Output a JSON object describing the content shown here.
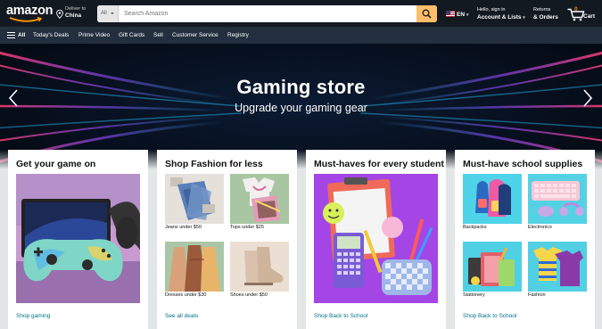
{
  "header": {
    "logo": "amazon",
    "deliver_to_label": "Deliver to",
    "deliver_to_location": "China",
    "search_category": "All",
    "search_placeholder": "Search Amazon",
    "language": "EN",
    "account_greeting": "Hello, sign in",
    "account_label": "Account & Lists",
    "returns_label": "Returns",
    "orders_label": "& Orders",
    "cart_count": "0",
    "cart_label": "Cart"
  },
  "subnav": {
    "all_label": "All",
    "items": [
      "Today's Deals",
      "Prime Video",
      "Gift Cards",
      "Sell",
      "Customer Service",
      "Registry"
    ]
  },
  "hero": {
    "title": "Gaming store",
    "subtitle": "Upgrade your gaming gear"
  },
  "cards": [
    {
      "title": "Get your game on",
      "footer_link": "Shop gaming"
    },
    {
      "title": "Shop Fashion for less",
      "footer_link": "See all deals",
      "tiles": [
        "Jeans under $50",
        "Tops under $25",
        "Dresses under $30",
        "Shoes under $50"
      ]
    },
    {
      "title": "Must-haves for every student",
      "footer_link": "Shop Back to School"
    },
    {
      "title": "Must-have school supplies",
      "footer_link": "Shop Back to School",
      "tiles": [
        "Backpacks",
        "Electronics",
        "Stationery",
        "Fashion"
      ]
    }
  ],
  "colors": {
    "nav_top": "#131921",
    "nav_sub": "#232f3e",
    "search_button": "#febd69",
    "link": "#007185",
    "page_bg": "#e3e6e6"
  },
  "icons": [
    "location-pin-icon",
    "search-icon",
    "cart-icon",
    "menu-icon",
    "chevron-left-icon",
    "chevron-right-icon"
  ]
}
